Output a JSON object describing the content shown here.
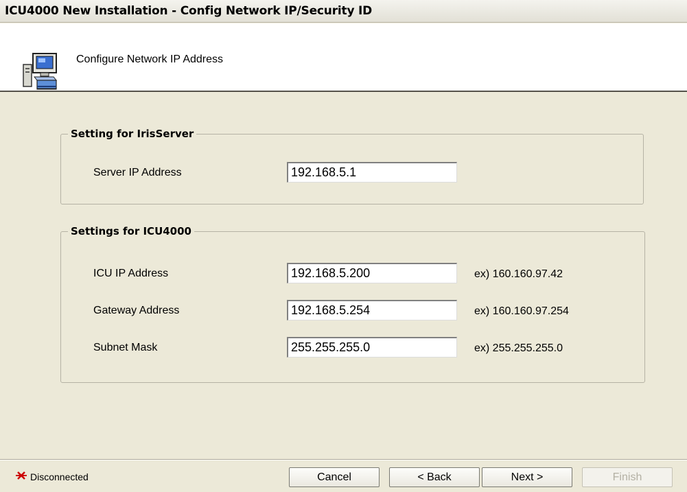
{
  "window": {
    "title": "ICU4000 New Installation - Config Network IP/Security ID"
  },
  "header": {
    "title": "Configure Network IP Address",
    "icon": "computer-config-icon"
  },
  "server_group": {
    "legend": "Setting for IrisServer",
    "server_ip": {
      "label": "Server IP Address",
      "value": "192.168.5.1"
    }
  },
  "icu_group": {
    "legend": "Settings for ICU4000",
    "icu_ip": {
      "label": "ICU IP Address",
      "value": "192.168.5.200",
      "hint": "ex) 160.160.97.42"
    },
    "gateway": {
      "label": "Gateway Address",
      "value": "192.168.5.254",
      "hint": "ex) 160.160.97.254"
    },
    "subnet": {
      "label": "Subnet Mask",
      "value": "255.255.255.0",
      "hint": "ex) 255.255.255.0"
    }
  },
  "status": {
    "text": "Disconnected",
    "icon": "disconnected-icon",
    "color": "#cc0000"
  },
  "buttons": {
    "cancel": "Cancel",
    "back": "< Back",
    "next": "Next >",
    "finish": "Finish"
  }
}
